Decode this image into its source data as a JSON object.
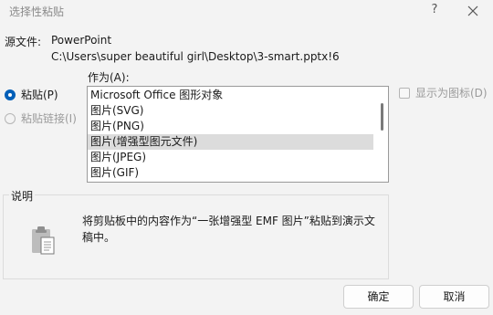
{
  "window": {
    "title": "选择性粘贴",
    "help_glyph": "?",
    "close_glyph": "✕"
  },
  "source": {
    "label": "源文件:",
    "app": "PowerPoint",
    "path": "C:\\Users\\super beautiful girl\\Desktop\\3-smart.pptx!6"
  },
  "paste_options": {
    "paste_label": "粘贴(P)",
    "paste_link_label": "粘贴链接(I)",
    "selected": "paste"
  },
  "as_list": {
    "label": "作为(A):",
    "items": [
      "Microsoft Office 图形对象",
      "图片(SVG)",
      "图片(PNG)",
      "图片(增强型图元文件)",
      "图片(JPEG)",
      "图片(GIF)"
    ],
    "selected_index": 3
  },
  "display_as_icon": {
    "label": "显示为图标(D)",
    "checked": false
  },
  "description": {
    "label": "说明",
    "text": "将剪贴板中的内容作为“一张增强型 EMF 图片”粘贴到演示文稿中。"
  },
  "buttons": {
    "ok": "确定",
    "cancel": "取消"
  },
  "colors": {
    "accent": "#005fb8",
    "selection": "#dcdcdc"
  }
}
